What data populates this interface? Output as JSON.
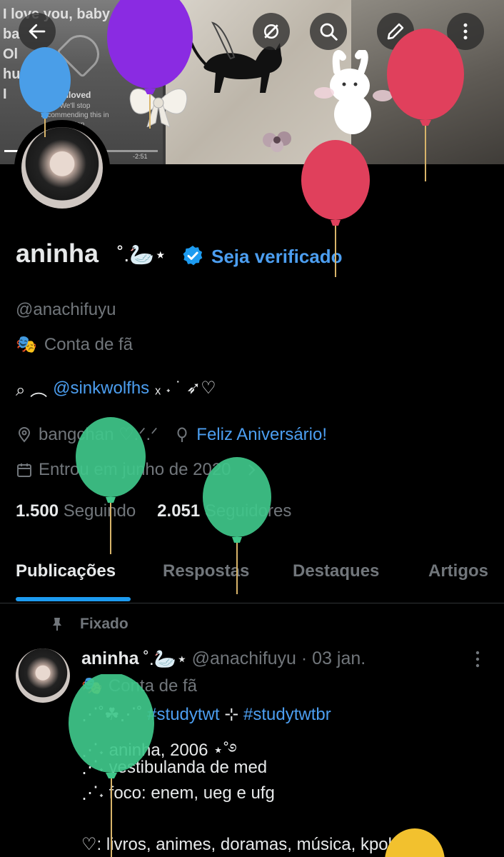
{
  "banner": {
    "panel1_text": "I love you, baby\nba\nOl\nhu\nI",
    "unloved_label": "Unloved",
    "unloved_sub": "We'll stop recommending this in Listen",
    "time": "-2:51"
  },
  "nav": {
    "back": "back-arrow-icon",
    "grok": "grok-icon",
    "search": "search-icon",
    "edit": "edit-icon",
    "more": "more-vertical-icon"
  },
  "profile": {
    "name": "aninha",
    "name_deco": "˚.🦢⋆",
    "get_verified": "Seja verificado",
    "handle": "@anachifuyu",
    "category": "Conta de fã",
    "bio_prefix": "⌕ ︵",
    "bio_mention": "@sinkwolfhs",
    "bio_suffix": "ₓ ˖ ˙ ➶♡",
    "location": "bangchan ♡.ᐟ.ᐟ",
    "birthday": "Feliz Aniversário!",
    "joined": "Entrou em junho de 2020",
    "following_count": "1.500",
    "following_label": "Seguindo",
    "followers_count": "2.051",
    "followers_label": "Seguidores"
  },
  "tabs": [
    "Publicações",
    "Respostas",
    "Destaques",
    "Artigos"
  ],
  "post": {
    "pinned_label": "Fixado",
    "name": "aninha",
    "name_deco": "˚.🦢⋆",
    "handle_date": "@anachifuyu · 03 jan.",
    "category": "Conta de fã",
    "line1_prefix": "⋰˚☘︎⋰˚",
    "line1_tag1": "#studytwt",
    "line1_sep": "⊹",
    "line1_tag2": "#studytwtbr",
    "line2": "⋰˖ aninha, 2006 ⋆˚࿔",
    "line3": "⋰˖ vestibulanda de med",
    "line4": "⋰˖ foco: enem, ueg e ufg",
    "line5": "♡: livros, animes, doramas, música, kpok,"
  },
  "colors": {
    "accent": "#1d9bf0",
    "link": "#4c9ef0",
    "muted": "#71767b",
    "balloon_blue": "#4a9ee8",
    "balloon_purple": "#8a2be2",
    "balloon_red": "#e0405c",
    "balloon_green": "#3fc78a",
    "balloon_yellow": "#f2c12e"
  }
}
